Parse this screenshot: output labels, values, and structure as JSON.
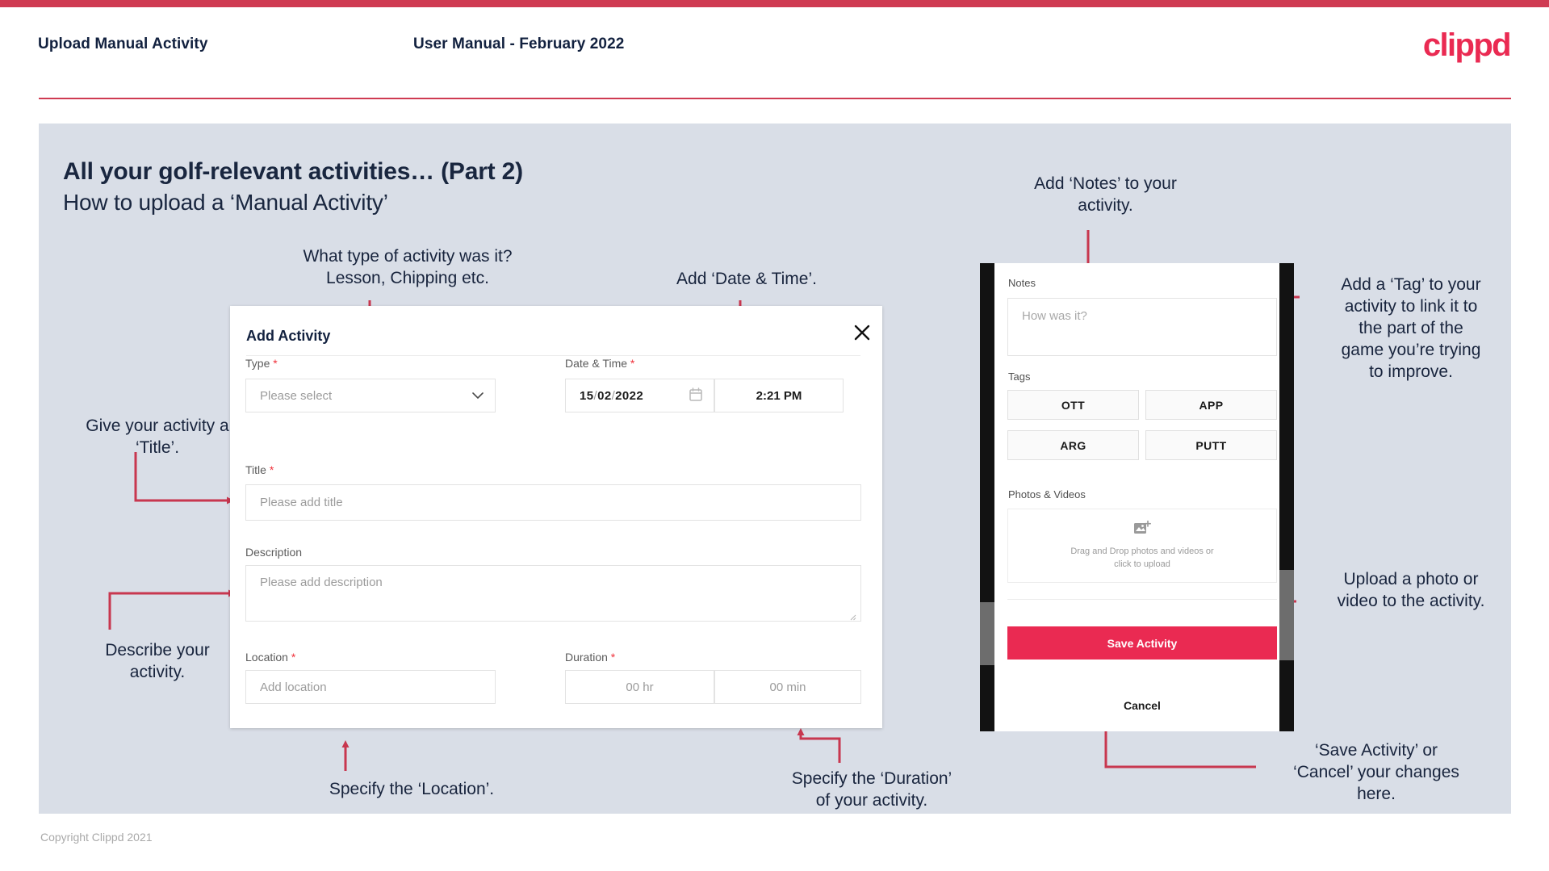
{
  "header": {
    "title": "Upload Manual Activity",
    "subtitle": "User Manual - February 2022",
    "logo": "clippd"
  },
  "slide": {
    "title": "All your golf-relevant activities… (Part 2)",
    "subtitle": "How to upload a ‘Manual Activity’"
  },
  "callouts": {
    "type": "What type of activity was it?\nLesson, Chipping etc.",
    "datetime": "Add ‘Date & Time’.",
    "title_field": "Give your activity a\n‘Title’.",
    "description": "Describe your\nactivity.",
    "location": "Specify the ‘Location’.",
    "duration": "Specify the ‘Duration’\nof your activity.",
    "notes": "Add ‘Notes’ to your\nactivity.",
    "tags": "Add a ‘Tag’ to your\nactivity to link it to\nthe part of the\ngame you’re trying\nto improve.",
    "upload": "Upload a photo or\nvideo to the activity.",
    "save_cancel": "‘Save Activity’ or\n‘Cancel’ your changes\nhere."
  },
  "dialog": {
    "title": "Add Activity",
    "close_icon": "close-icon",
    "fields": {
      "type": {
        "label": "Type",
        "required": true,
        "placeholder": "Please select",
        "value": ""
      },
      "datetime": {
        "label": "Date & Time",
        "required": true,
        "day": "15",
        "month": "02",
        "year": "2022",
        "sep": "/",
        "time": "2:21 PM",
        "calendar_icon": "calendar-icon"
      },
      "title": {
        "label": "Title",
        "required": true,
        "placeholder": "Please add title",
        "value": ""
      },
      "description": {
        "label": "Description",
        "required": false,
        "placeholder": "Please add description",
        "value": ""
      },
      "location": {
        "label": "Location",
        "required": true,
        "placeholder": "Add location",
        "value": ""
      },
      "duration": {
        "label": "Duration",
        "required": true,
        "hours": "00 hr",
        "minutes": "00 min"
      }
    }
  },
  "phone": {
    "notes": {
      "label": "Notes",
      "placeholder": "How was it?",
      "value": ""
    },
    "tags": {
      "label": "Tags",
      "items": [
        "OTT",
        "APP",
        "ARG",
        "PUTT"
      ]
    },
    "photos": {
      "label": "Photos & Videos",
      "drop_text_line1": "Drag and Drop photos and videos or",
      "drop_text_line2": "click to upload",
      "icon": "add-image-icon"
    },
    "save_label": "Save Activity",
    "cancel_label": "Cancel"
  },
  "footer": {
    "copyright": "Copyright Clippd 2021"
  },
  "colors": {
    "brand_pink": "#ea2a52",
    "top_bar": "#cf3b52",
    "slide_bg": "#d9dee7",
    "arrow": "#c8374f",
    "ink": "#19263f",
    "required": "#f0323c"
  }
}
